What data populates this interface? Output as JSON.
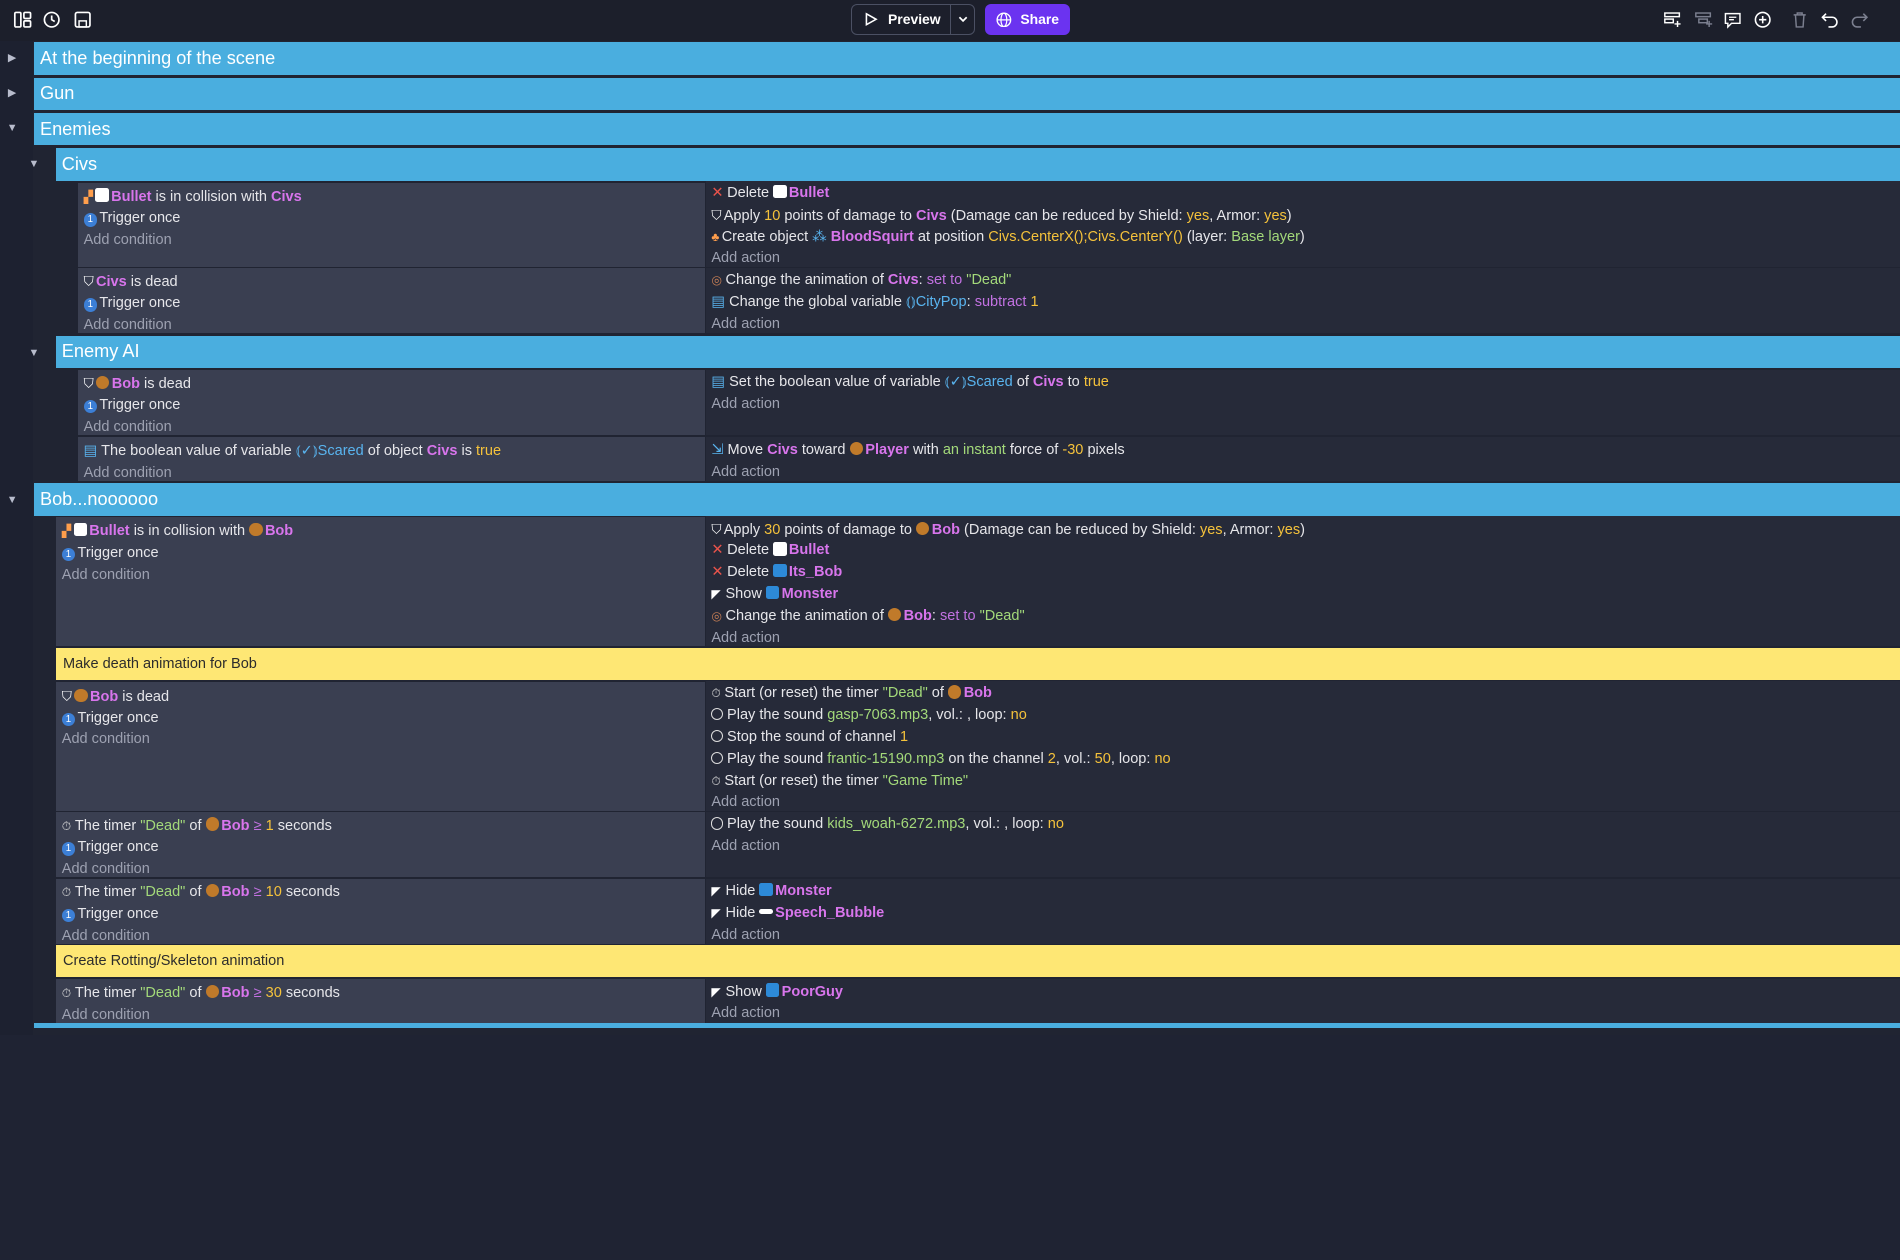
{
  "toolbar": {
    "preview_label": "Preview",
    "share_label": "Share",
    "left_icons": [
      "layout-icon",
      "history-icon",
      "save-icon"
    ],
    "right_icons": [
      "add-event-icon",
      "add-subevent-icon",
      "add-comment-icon",
      "add-other-icon",
      "delete-icon",
      "undo-icon",
      "redo-icon"
    ]
  },
  "common": {
    "add_condition": "Add condition",
    "add_action": "Add action",
    "trigger_once": "Trigger once"
  },
  "groups": {
    "beginning": "At the beginning of the scene",
    "gun": "Gun",
    "enemies": "Enemies",
    "civs": "Civs",
    "enemy_ai": "Enemy AI",
    "bob": "Bob...noooooo"
  },
  "comments": {
    "death_anim": "Make death animation for Bob",
    "rotting": "Create Rotting/Skeleton animation"
  },
  "words": {
    "bullet": "Bullet",
    "civs": "Civs",
    "bob": "Bob",
    "player": "Player",
    "monster": "Monster",
    "its_bob": "Its_Bob",
    "speech_bubble": "Speech_Bubble",
    "poorguy": "PoorGuy",
    "bloodsquirt": "BloodSquirt",
    "scared": "Scared",
    "citypop": "CityPop",
    "yes": "yes",
    "no": "no",
    "true": "true",
    "dead_str": "\"Dead\"",
    "gametime_str": "\"Game Time\"",
    "set_to": "set to",
    "subtract": "subtract",
    "base_layer": "Base layer",
    "center_expr": "Civs.CenterX();Civs.CenterY()",
    "instant": "an instant",
    "n10": "10",
    "n30": "30",
    "n1": "1",
    "n2": "2",
    "n50": "50",
    "n_30": "-30",
    "gasp": "gasp-7063.mp3",
    "frantic": "frantic-15190.mp3",
    "kids": "kids_woah-6272.mp3"
  }
}
